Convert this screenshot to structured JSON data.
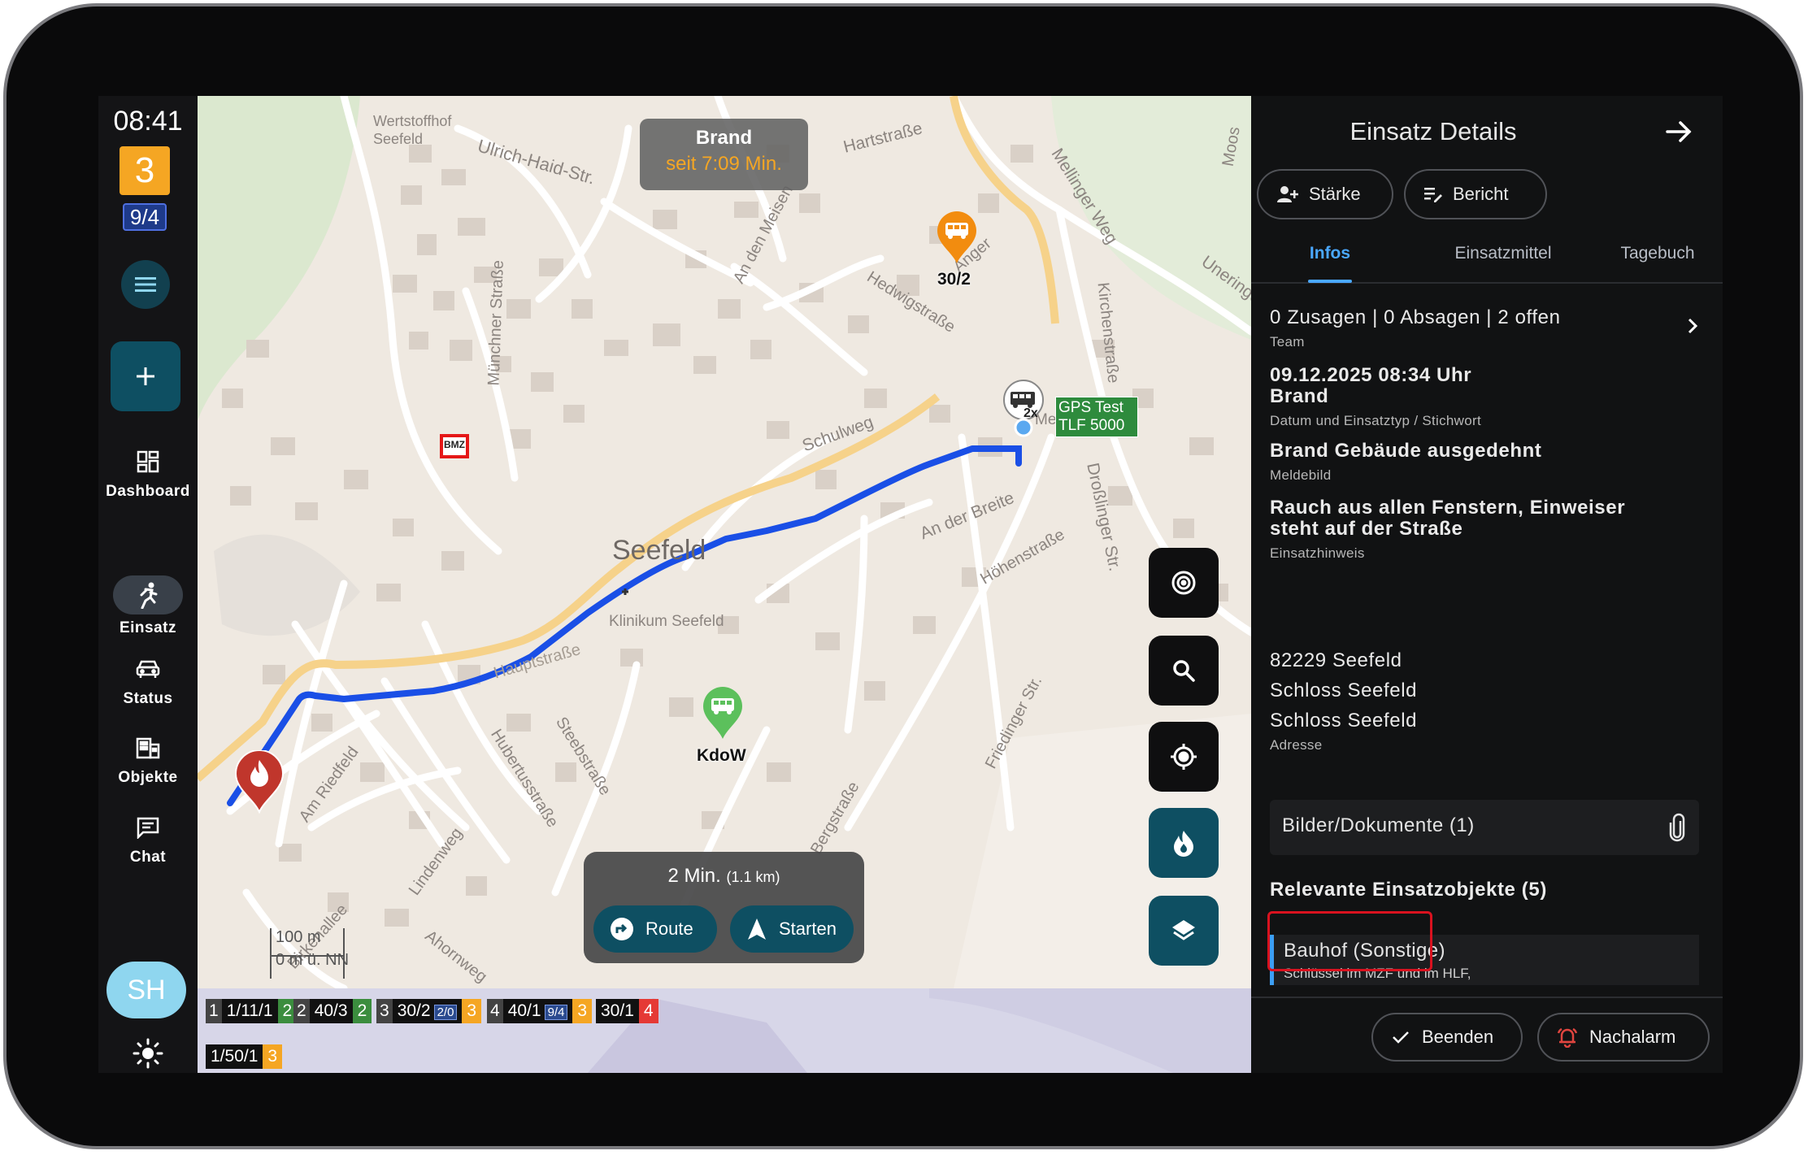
{
  "sidebar": {
    "clock": "08:41",
    "status_number": "3",
    "status_sub": "9/4",
    "menu_icon": "hamburger-icon",
    "add_icon": "plus-icon",
    "nav": [
      {
        "label": "Dashboard",
        "icon": "dashboard-icon"
      },
      {
        "label": "Einsatz",
        "icon": "running-person-icon"
      },
      {
        "label": "Status",
        "icon": "car-icon"
      },
      {
        "label": "Objekte",
        "icon": "building-icon"
      },
      {
        "label": "Chat",
        "icon": "chat-icon"
      }
    ],
    "active_nav": "Einsatz",
    "avatar": "SH",
    "theme_icon": "sun-icon"
  },
  "map": {
    "incident_tag": {
      "title": "Brand",
      "timer": "seit 7:09 Min."
    },
    "labels": {
      "wertstoffhof": "Wertstoffhof\nSeefeld",
      "ulrich": "Ulrich-Haid-Str.",
      "hartstrasse": "Hartstraße",
      "melling": "Mellinger Weg",
      "moos": "Moos",
      "uneringer": "Uneringer Str.",
      "muenchner": "Münchner Straße",
      "anger": "Anger",
      "hedwig": "Hedwigstraße",
      "kirchenstrasse": "Kirchenstraße",
      "meisenweg": "An den Meisen",
      "schulweg": "Schulweg",
      "metzger": "Metzgerei",
      "seefeld": "Seefeld",
      "klinikum": "Klinikum Seefeld",
      "breite": "An der Breite",
      "hoehen": "Höhenstraße",
      "drosslinger": "Droßlinger Str.",
      "friedinger": "Friedinger Str.",
      "berg": "Bergstraße",
      "steeb": "Steebstraße",
      "hubertus": "Hubertusstraße",
      "riedfeld": "Am Riedfeld",
      "linden": "Lindenweg",
      "ahorn": "Ahornweg",
      "birken": "Birkenallee",
      "hauptstrasse": "Hauptstraße",
      "bmz": "BMZ",
      "scale_m": "100 m",
      "elevation": "0 m ü. NN"
    },
    "pins": [
      {
        "label": "30/2",
        "icon": "bus-icon",
        "color": "#f28c0f"
      },
      {
        "label": "KdoW",
        "icon": "bus-icon",
        "color": "#5cc05c"
      }
    ],
    "gps_tag": "GPS Test\nTLF 5000",
    "vehicle_badge": "2x",
    "controls": [
      "radar-icon",
      "search-icon",
      "locate-icon",
      "fire-icon",
      "layers-icon"
    ],
    "route": {
      "time": "2 Min.",
      "distance": "(1.1 km)",
      "route_label": "Route",
      "start_label": "Starten"
    },
    "units": [
      {
        "n": "1",
        "v": "1/11/1",
        "badge": "2",
        "badge_color": "#3b8d3e"
      },
      {
        "n": "2",
        "v": "40/3",
        "badge": "2",
        "badge_color": "#3b8d3e"
      },
      {
        "n": "3",
        "v": "30/2",
        "sub": "2/0",
        "badge": "3",
        "badge_color": "#f5a623"
      },
      {
        "n": "4",
        "v": "40/1",
        "sub": "9/4",
        "badge": "3",
        "badge_color": "#f5a623"
      },
      {
        "n": "",
        "v": "30/1",
        "badge": "4",
        "badge_color": "#e53935"
      },
      {
        "n": "",
        "v": "1/50/1",
        "badge": "3",
        "badge_color": "#f5a623"
      }
    ]
  },
  "panel": {
    "title": "Einsatz Details",
    "staerke": "Stärke",
    "bericht": "Bericht",
    "tabs": [
      "Infos",
      "Einsatzmittel",
      "Tagebuch"
    ],
    "active_tab": "Infos",
    "responses": "0 Zusagen | 0 Absagen | 2 offen",
    "responses_label": "Team",
    "datetime": "09.12.2025 08:34 Uhr",
    "type": "Brand",
    "datetime_label": "Datum und Einsatztyp / Stichwort",
    "meldebild": "Brand Gebäude ausgedehnt",
    "meldebild_label": "Meldebild",
    "hinweis_1": "Rauch aus allen Fenstern, Einweiser",
    "hinweis_2": "steht auf der Straße",
    "hinweis_label": "Einsatzhinweis",
    "address_1": "82229 Seefeld",
    "address_2": "Schloss Seefeld",
    "address_3": "Schloss Seefeld",
    "address_label": "Adresse",
    "documents": "Bilder/Dokumente (1)",
    "objects_heading": "Relevante Einsatzobjekte (5)",
    "object_title": "Bauhof (Sonstige)",
    "object_sub": "Schlüssel im MZF und im HLF,",
    "beenden": "Beenden",
    "nachalarm": "Nachalarm"
  }
}
